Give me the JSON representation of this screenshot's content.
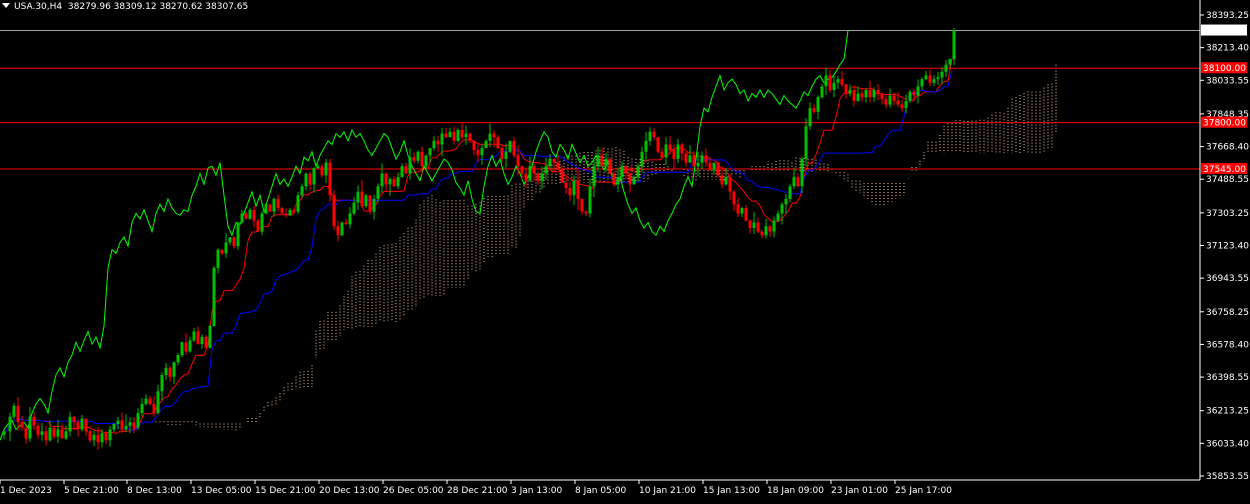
{
  "window": {
    "symbol": "USA.30,H4",
    "ohlc": "38279.96 38309.12 38270.62 38307.65"
  },
  "colors": {
    "background": "#000000",
    "axis": "#ffffff",
    "bull": "#00c000",
    "bear": "#ff0000",
    "tenkan": "#ff0000",
    "kijun": "#0000ff",
    "chikou": "#00ff00",
    "kumo": "#ffc8a0",
    "level_line": "#ff0000",
    "price_line": "#ffffff"
  },
  "chart_data": {
    "type": "candlestick",
    "y_axis_labels": [
      "38393.25",
      "38213.40",
      "38033.55",
      "37848.35",
      "37668.40",
      "37488.55",
      "37303.25",
      "37123.40",
      "36943.55",
      "36758.25",
      "36578.40",
      "36398.55",
      "36213.25",
      "36033.40",
      "35853.55"
    ],
    "x_axis_labels": [
      "1 Dec 2023",
      "5 Dec 21:00",
      "8 Dec 13:00",
      "13 Dec 05:00",
      "15 Dec 21:00",
      "20 Dec 13:00",
      "26 Dec 05:00",
      "28 Dec 21:00",
      "3 Jan 13:00",
      "8 Jan 05:00",
      "10 Jan 21:00",
      "15 Jan 13:00",
      "18 Jan 09:00",
      "23 Jan 01:00",
      "25 Jan 17:00"
    ],
    "current_price": "38307.65",
    "levels": [
      "38100.00",
      "37800.00",
      "37545.00"
    ],
    "ylim": [
      35853.55,
      38393.25
    ],
    "close_path": [
      [
        0,
        36100
      ],
      [
        6,
        36180
      ],
      [
        10,
        36240
      ],
      [
        14,
        36150
      ],
      [
        18,
        36120
      ],
      [
        22,
        36060
      ],
      [
        26,
        36180
      ],
      [
        30,
        36130
      ],
      [
        34,
        36080
      ],
      [
        38,
        36100
      ],
      [
        42,
        36050
      ],
      [
        46,
        36120
      ],
      [
        50,
        36070
      ],
      [
        54,
        36110
      ],
      [
        58,
        36060
      ],
      [
        62,
        36100
      ],
      [
        66,
        36180
      ],
      [
        70,
        36150
      ],
      [
        74,
        36110
      ],
      [
        78,
        36170
      ],
      [
        82,
        36100
      ],
      [
        86,
        36050
      ],
      [
        90,
        36080
      ],
      [
        94,
        36040
      ],
      [
        98,
        36090
      ],
      [
        102,
        36050
      ],
      [
        106,
        36110
      ],
      [
        110,
        36140
      ],
      [
        114,
        36160
      ],
      [
        118,
        36110
      ],
      [
        122,
        36130
      ],
      [
        126,
        36150
      ],
      [
        130,
        36120
      ],
      [
        134,
        36200
      ],
      [
        138,
        36250
      ],
      [
        142,
        36280
      ],
      [
        146,
        36250
      ],
      [
        150,
        36200
      ],
      [
        154,
        36320
      ],
      [
        158,
        36410
      ],
      [
        162,
        36450
      ],
      [
        166,
        36400
      ],
      [
        170,
        36480
      ],
      [
        174,
        36520
      ],
      [
        178,
        36590
      ],
      [
        182,
        36540
      ],
      [
        186,
        36600
      ],
      [
        190,
        36650
      ],
      [
        194,
        36580
      ],
      [
        198,
        36620
      ],
      [
        202,
        36560
      ],
      [
        206,
        36680
      ],
      [
        210,
        37000
      ],
      [
        214,
        37100
      ],
      [
        218,
        37080
      ],
      [
        222,
        37140
      ],
      [
        226,
        37170
      ],
      [
        230,
        37120
      ],
      [
        234,
        37250
      ],
      [
        238,
        37300
      ],
      [
        242,
        37270
      ],
      [
        246,
        37320
      ],
      [
        250,
        37260
      ],
      [
        254,
        37200
      ],
      [
        258,
        37300
      ],
      [
        262,
        37350
      ],
      [
        266,
        37310
      ],
      [
        270,
        37380
      ],
      [
        274,
        37330
      ],
      [
        278,
        37300
      ],
      [
        282,
        37290
      ],
      [
        286,
        37320
      ],
      [
        290,
        37310
      ],
      [
        294,
        37400
      ],
      [
        298,
        37450
      ],
      [
        302,
        37520
      ],
      [
        306,
        37460
      ],
      [
        310,
        37550
      ],
      [
        314,
        37560
      ],
      [
        318,
        37510
      ],
      [
        322,
        37580
      ],
      [
        326,
        37400
      ],
      [
        330,
        37230
      ],
      [
        334,
        37180
      ],
      [
        338,
        37250
      ],
      [
        342,
        37240
      ],
      [
        346,
        37300
      ],
      [
        350,
        37360
      ],
      [
        354,
        37420
      ],
      [
        358,
        37340
      ],
      [
        362,
        37400
      ],
      [
        366,
        37310
      ],
      [
        370,
        37380
      ],
      [
        374,
        37450
      ],
      [
        378,
        37520
      ],
      [
        382,
        37460
      ],
      [
        386,
        37490
      ],
      [
        390,
        37450
      ],
      [
        394,
        37500
      ],
      [
        398,
        37560
      ],
      [
        402,
        37520
      ],
      [
        406,
        37610
      ],
      [
        410,
        37590
      ],
      [
        414,
        37640
      ],
      [
        418,
        37560
      ],
      [
        422,
        37620
      ],
      [
        426,
        37660
      ],
      [
        430,
        37700
      ],
      [
        434,
        37680
      ],
      [
        438,
        37740
      ],
      [
        442,
        37720
      ],
      [
        446,
        37750
      ],
      [
        450,
        37700
      ],
      [
        454,
        37760
      ],
      [
        458,
        37720
      ],
      [
        462,
        37740
      ],
      [
        466,
        37700
      ],
      [
        470,
        37650
      ],
      [
        474,
        37620
      ],
      [
        478,
        37660
      ],
      [
        482,
        37700
      ],
      [
        486,
        37740
      ],
      [
        490,
        37720
      ],
      [
        494,
        37660
      ],
      [
        498,
        37600
      ],
      [
        502,
        37640
      ],
      [
        506,
        37700
      ],
      [
        510,
        37620
      ],
      [
        514,
        37560
      ],
      [
        518,
        37520
      ],
      [
        522,
        37480
      ],
      [
        526,
        37560
      ],
      [
        530,
        37520
      ],
      [
        534,
        37480
      ],
      [
        538,
        37520
      ],
      [
        542,
        37560
      ],
      [
        546,
        37600
      ],
      [
        550,
        37580
      ],
      [
        554,
        37540
      ],
      [
        558,
        37470
      ],
      [
        562,
        37440
      ],
      [
        566,
        37400
      ],
      [
        570,
        37480
      ],
      [
        574,
        37380
      ],
      [
        578,
        37310
      ],
      [
        582,
        37300
      ],
      [
        586,
        37450
      ],
      [
        590,
        37560
      ],
      [
        594,
        37620
      ],
      [
        598,
        37560
      ],
      [
        602,
        37600
      ],
      [
        606,
        37520
      ],
      [
        610,
        37460
      ],
      [
        614,
        37500
      ],
      [
        618,
        37560
      ],
      [
        622,
        37520
      ],
      [
        626,
        37460
      ],
      [
        630,
        37500
      ],
      [
        634,
        37560
      ],
      [
        638,
        37640
      ],
      [
        642,
        37700
      ],
      [
        646,
        37750
      ],
      [
        650,
        37720
      ],
      [
        654,
        37640
      ],
      [
        658,
        37610
      ],
      [
        662,
        37680
      ],
      [
        666,
        37650
      ],
      [
        670,
        37600
      ],
      [
        674,
        37680
      ],
      [
        678,
        37630
      ],
      [
        682,
        37580
      ],
      [
        686,
        37620
      ],
      [
        690,
        37560
      ],
      [
        694,
        37580
      ],
      [
        698,
        37620
      ],
      [
        702,
        37580
      ],
      [
        706,
        37540
      ],
      [
        710,
        37580
      ],
      [
        714,
        37510
      ],
      [
        718,
        37460
      ],
      [
        722,
        37500
      ],
      [
        726,
        37420
      ],
      [
        730,
        37350
      ],
      [
        734,
        37300
      ],
      [
        738,
        37330
      ],
      [
        742,
        37260
      ],
      [
        746,
        37220
      ],
      [
        750,
        37250
      ],
      [
        754,
        37200
      ],
      [
        758,
        37180
      ],
      [
        762,
        37230
      ],
      [
        766,
        37200
      ],
      [
        770,
        37260
      ],
      [
        774,
        37300
      ],
      [
        778,
        37350
      ],
      [
        782,
        37380
      ],
      [
        786,
        37450
      ],
      [
        790,
        37500
      ],
      [
        794,
        37450
      ],
      [
        798,
        37600
      ],
      [
        802,
        37780
      ],
      [
        806,
        37880
      ],
      [
        810,
        37860
      ],
      [
        814,
        37940
      ],
      [
        818,
        38000
      ],
      [
        822,
        38060
      ],
      [
        826,
        37980
      ],
      [
        830,
        38020
      ],
      [
        834,
        38040
      ],
      [
        838,
        38010
      ],
      [
        842,
        37960
      ],
      [
        846,
        37980
      ],
      [
        850,
        37920
      ],
      [
        854,
        37960
      ],
      [
        858,
        37940
      ],
      [
        862,
        37980
      ],
      [
        866,
        37940
      ],
      [
        870,
        37980
      ],
      [
        874,
        37960
      ],
      [
        878,
        37930
      ],
      [
        882,
        37900
      ],
      [
        886,
        37950
      ],
      [
        890,
        37920
      ],
      [
        894,
        37900
      ],
      [
        898,
        37880
      ],
      [
        902,
        37920
      ],
      [
        906,
        37970
      ],
      [
        910,
        37950
      ],
      [
        914,
        38000
      ],
      [
        918,
        38040
      ],
      [
        922,
        38060
      ],
      [
        926,
        38020
      ],
      [
        930,
        38040
      ],
      [
        934,
        38050
      ],
      [
        938,
        38080
      ],
      [
        942,
        38120
      ],
      [
        946,
        38150
      ],
      [
        950,
        38308
      ]
    ]
  }
}
